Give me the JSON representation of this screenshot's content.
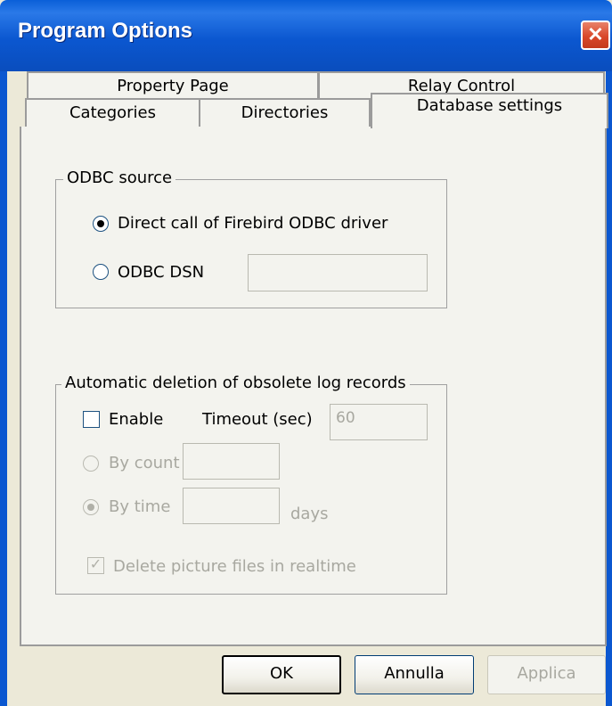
{
  "window": {
    "title": "Program Options",
    "close_glyph": "✕"
  },
  "tabs": {
    "back_row": [
      "Property Page",
      "Relay Control"
    ],
    "front_row": [
      "Categories",
      "Directories",
      "Database settings"
    ],
    "active": "Database settings"
  },
  "odbc": {
    "caption": "ODBC source",
    "direct_label": "Direct call of Firebird ODBC driver",
    "direct_checked": true,
    "dsn_label": "ODBC DSN",
    "dsn_checked": false,
    "dsn_value": ""
  },
  "deletion": {
    "caption": "Automatic deletion of obsolete log records",
    "enable_label": "Enable",
    "enable_checked": false,
    "timeout_label": "Timeout (sec)",
    "timeout_value": "60",
    "by_count_label": "By count",
    "by_count_value": "",
    "by_time_label": "By time",
    "by_time_value": "",
    "days_label": "days",
    "delete_pictures_label": "Delete picture files in realtime",
    "delete_pictures_checked": true
  },
  "buttons": {
    "ok": "OK",
    "cancel": "Annulla",
    "apply": "Applica"
  },
  "colors": {
    "title_bar": "#0b57d0",
    "close_button": "#d9482a",
    "dialog_face": "#ece9d8",
    "tab_face": "#f3f3ee"
  },
  "icons": {
    "close": "close-icon",
    "radio_selected": "radio-selected-icon",
    "checkbox_checked": "check-mark-icon"
  }
}
